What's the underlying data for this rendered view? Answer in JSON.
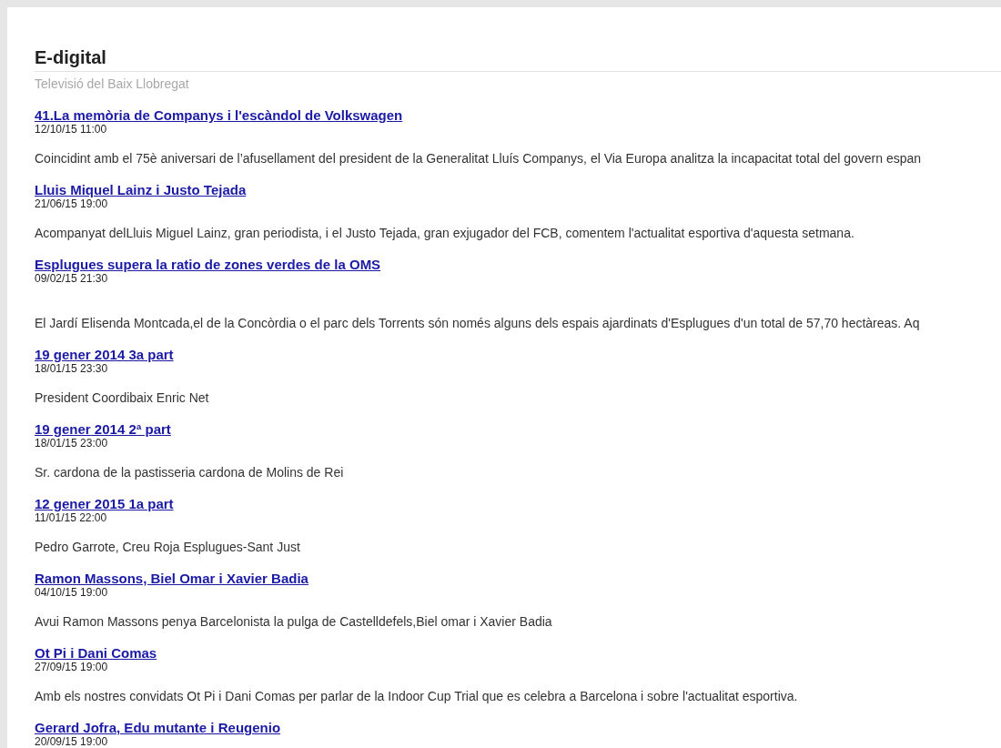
{
  "site": {
    "title": "E-digital",
    "subtitle": "Televisió del Baix Llobregat"
  },
  "posts": [
    {
      "title": "41.La memòria de Companys i l'escàndol de Volkswagen",
      "date": "12/10/15 11:00",
      "extra_gap": false,
      "summary": "Coincidint amb el 75è aniversari de l’afusellament del president de la Generalitat Lluís Companys, el Via Europa analitza la incapacitat total del govern espan"
    },
    {
      "title": "Lluis Miquel Lainz i Justo Tejada",
      "date": "21/06/15 19:00",
      "extra_gap": false,
      "summary": "Acompanyat delLluis Miguel Lainz, gran periodista, i el Justo Tejada, gran exjugador del FCB, comentem l'actualitat esportiva d'aquesta setmana."
    },
    {
      "title": "Esplugues supera la ratio de zones verdes de la OMS",
      "date": "09/02/15 21:30",
      "extra_gap": true,
      "summary": "El Jardí Elisenda Montcada,el de la Concòrdia o el parc dels Torrents són només alguns dels espais ajardinats d'Esplugues d'un total de 57,70 hectàreas. Aq"
    },
    {
      "title": "19 gener 2014 3a part",
      "date": "18/01/15 23:30",
      "extra_gap": false,
      "summary": "President Coordibaix Enric Net"
    },
    {
      "title": "19 gener 2014 2ª part",
      "date": "18/01/15 23:00",
      "extra_gap": false,
      "summary": "Sr. cardona de la pastisseria cardona de Molins de Rei"
    },
    {
      "title": "12 gener 2015 1a part",
      "date": "11/01/15 22:00",
      "extra_gap": false,
      "summary": "Pedro Garrote, Creu Roja Esplugues-Sant Just"
    },
    {
      "title": "Ramon Massons, Biel Omar i Xavier Badia",
      "date": "04/10/15 19:00",
      "extra_gap": false,
      "summary": "Avui Ramon Massons penya Barcelonista la pulga de Castelldefels,Biel omar i Xavier Badia"
    },
    {
      "title": "Ot Pi i Dani Comas",
      "date": "27/09/15 19:00",
      "extra_gap": false,
      "summary": "Amb els nostres convidats Ot Pi i Dani Comas per parlar de la Indoor Cup Trial que es celebra a Barcelona i sobre l'actualitat esportiva."
    },
    {
      "title": "Gerard Jofra, Edu mutante i Reugenio",
      "date": "20/09/15 19:00",
      "extra_gap": false
    }
  ]
}
